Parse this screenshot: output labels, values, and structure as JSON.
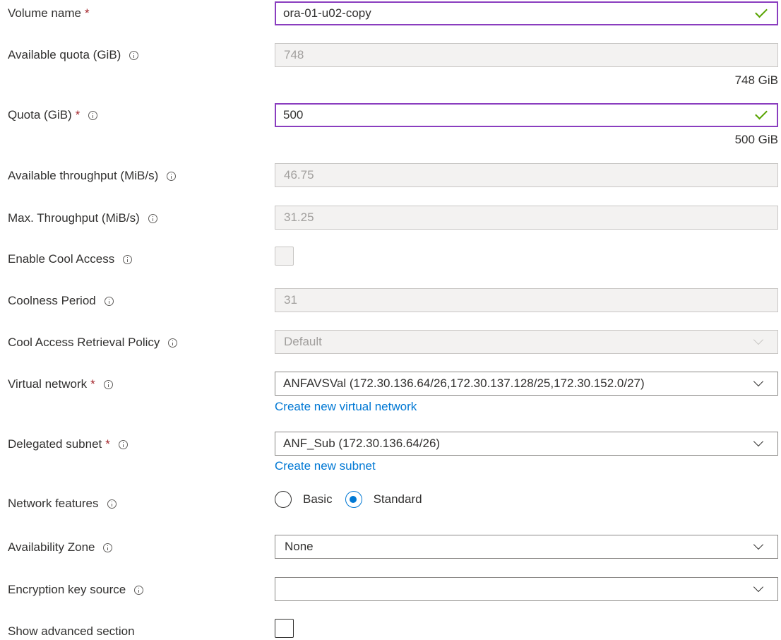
{
  "fields": {
    "volume_name": {
      "label": "Volume name",
      "required": "*",
      "value": "ora-01-u02-copy"
    },
    "available_quota": {
      "label": "Available quota (GiB)",
      "value": "748",
      "hint": "748 GiB"
    },
    "quota": {
      "label": "Quota (GiB)",
      "required": "*",
      "value": "500",
      "hint": "500 GiB"
    },
    "available_throughput": {
      "label": "Available throughput (MiB/s)",
      "value": "46.75"
    },
    "max_throughput": {
      "label": "Max. Throughput (MiB/s)",
      "value": "31.25"
    },
    "enable_cool_access": {
      "label": "Enable Cool Access",
      "checked": false
    },
    "coolness_period": {
      "label": "Coolness Period",
      "value": "31"
    },
    "cool_access_retrieval_policy": {
      "label": "Cool Access Retrieval Policy",
      "value": "Default"
    },
    "virtual_network": {
      "label": "Virtual network",
      "required": "*",
      "value": "ANFAVSVal (172.30.136.64/26,172.30.137.128/25,172.30.152.0/27)",
      "link": "Create new virtual network"
    },
    "delegated_subnet": {
      "label": "Delegated subnet",
      "required": "*",
      "value": "ANF_Sub (172.30.136.64/26)",
      "link": "Create new subnet"
    },
    "network_features": {
      "label": "Network features",
      "options": [
        "Basic",
        "Standard"
      ],
      "selected": "Standard"
    },
    "availability_zone": {
      "label": "Availability Zone",
      "value": "None"
    },
    "encryption_key_source": {
      "label": "Encryption key source",
      "value": ""
    },
    "show_advanced_section": {
      "label": "Show advanced section",
      "checked": false
    }
  },
  "icons": {
    "info": "info-icon",
    "valid": "checkmark-icon",
    "dropdown": "chevron-down-icon"
  },
  "colors": {
    "focus_border": "#8a3dbf",
    "valid_check": "#57a300",
    "required": "#a4262c",
    "link": "#0078d4",
    "radio_selected": "#0078d4",
    "disabled_bg": "#f3f2f1"
  }
}
